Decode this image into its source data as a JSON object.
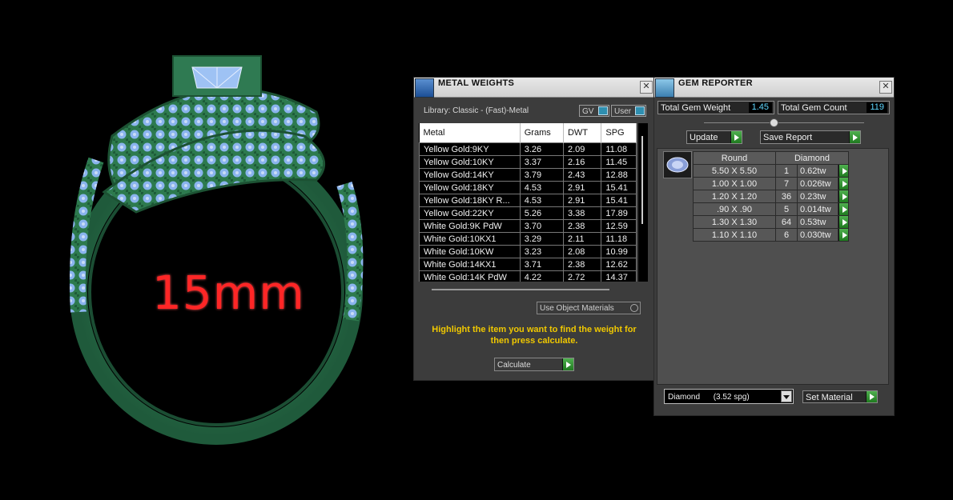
{
  "viewport": {
    "size_label": "15mm",
    "colors": {
      "metal": "#2f7a52",
      "gem": "#8ab4ee",
      "label": "#ff2626"
    }
  },
  "metal_weights": {
    "title": "METAL WEIGHTS",
    "library": "Library: Classic - (Fast)-Metal",
    "toggle_gv": "GV",
    "toggle_user": "User",
    "columns": [
      "Metal",
      "Grams",
      "DWT",
      "SPG"
    ],
    "rows": [
      [
        "Yellow Gold:9KY",
        "3.26",
        "2.09",
        "11.08"
      ],
      [
        "Yellow Gold:10KY",
        "3.37",
        "2.16",
        "11.45"
      ],
      [
        "Yellow Gold:14KY",
        "3.79",
        "2.43",
        "12.88"
      ],
      [
        "Yellow Gold:18KY",
        "4.53",
        "2.91",
        "15.41"
      ],
      [
        "Yellow Gold:18KY R...",
        "4.53",
        "2.91",
        "15.41"
      ],
      [
        "Yellow Gold:22KY",
        "5.26",
        "3.38",
        "17.89"
      ],
      [
        "White Gold:9K PdW",
        "3.70",
        "2.38",
        "12.59"
      ],
      [
        "White Gold:10KX1",
        "3.29",
        "2.11",
        "11.18"
      ],
      [
        "White Gold:10KW",
        "3.23",
        "2.08",
        "10.99"
      ],
      [
        "White Gold:14KX1",
        "3.71",
        "2.38",
        "12.62"
      ],
      [
        "White Gold:14K PdW",
        "4.22",
        "2.72",
        "14.37"
      ]
    ],
    "use_object_materials": "Use Object Materials",
    "instruction": "Highlight the item you want to find the weight for then press calculate.",
    "calculate": "Calculate"
  },
  "gem_reporter": {
    "title": "GEM REPORTER",
    "total_weight_label": "Total Gem Weight",
    "total_weight_value": "1.45",
    "total_count_label": "Total Gem Count",
    "total_count_value": "119",
    "update": "Update",
    "save_report": "Save Report",
    "group": {
      "cut": "Round",
      "material": "Diamond"
    },
    "stones": [
      {
        "size": "5.50 X 5.50",
        "count": "1",
        "weight": "0.62tw"
      },
      {
        "size": "1.00 X 1.00",
        "count": "7",
        "weight": "0.026tw"
      },
      {
        "size": "1.20 X 1.20",
        "count": "36",
        "weight": "0.23tw"
      },
      {
        "size": ".90 X .90",
        "count": "5",
        "weight": "0.014tw"
      },
      {
        "size": "1.30 X 1.30",
        "count": "64",
        "weight": "0.53tw"
      },
      {
        "size": "1.10 X 1.10",
        "count": "6",
        "weight": "0.030tw"
      }
    ],
    "material_select": "Diamond      (3.52 spg)",
    "set_material": "Set Material"
  }
}
